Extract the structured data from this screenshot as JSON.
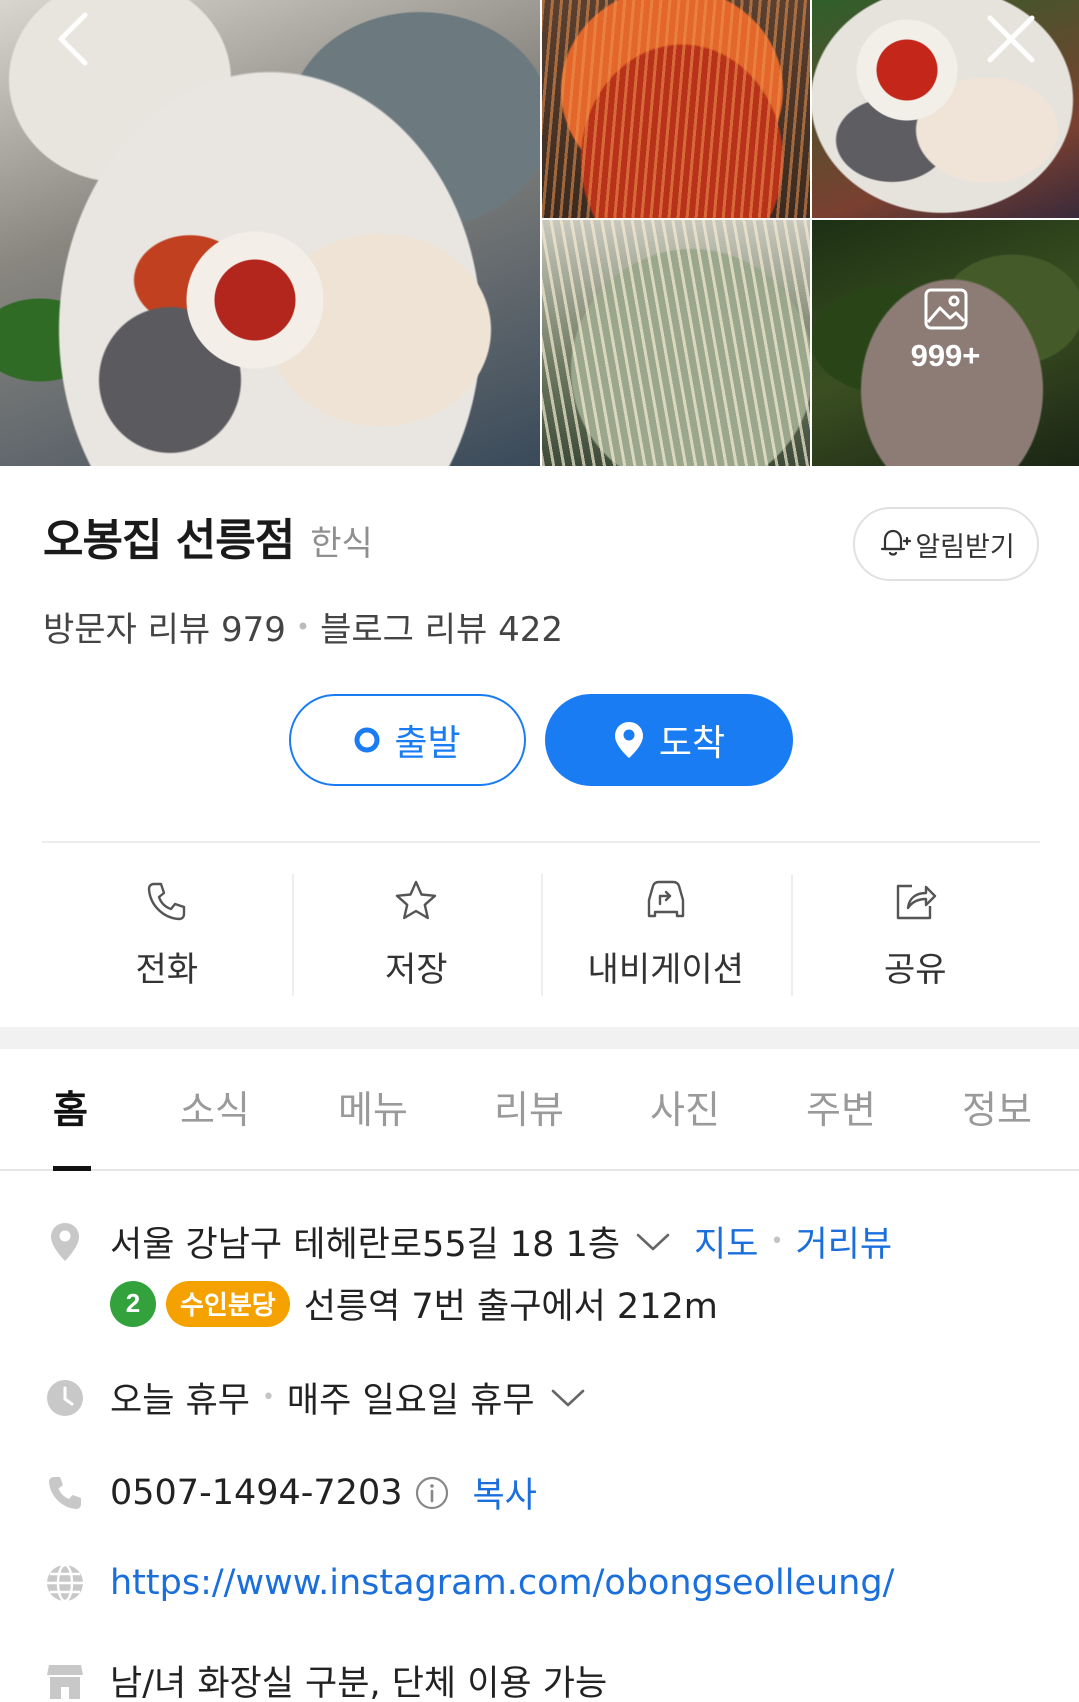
{
  "gallery": {
    "photos": [
      "photo-main",
      "photo-noodles",
      "photo-platter",
      "photo-hotpot",
      "photo-boiled-pork"
    ],
    "more_count": "999+",
    "icons": {
      "back": "chevron-left-icon",
      "close": "close-icon",
      "more": "image-icon"
    }
  },
  "place": {
    "name": "오봉집 선릉점",
    "category": "한식",
    "notify_label": "알림받기",
    "visitor_reviews": "방문자 리뷰 979",
    "blog_reviews": "블로그 리뷰 422",
    "separator": "•"
  },
  "route": {
    "depart_label": "출발",
    "arrive_label": "도착"
  },
  "actions": [
    {
      "label": "전화",
      "icon": "phone-icon"
    },
    {
      "label": "저장",
      "icon": "star-icon"
    },
    {
      "label": "내비게이션",
      "icon": "car-navigation-icon"
    },
    {
      "label": "공유",
      "icon": "share-icon"
    }
  ],
  "tabs": [
    {
      "label": "홈",
      "active": true
    },
    {
      "label": "소식"
    },
    {
      "label": "메뉴"
    },
    {
      "label": "리뷰"
    },
    {
      "label": "사진"
    },
    {
      "label": "주변"
    },
    {
      "label": "정보"
    }
  ],
  "info": {
    "address": "서울 강남구 테헤란로55길 18 1층",
    "map_link": "지도",
    "streetview_link": "거리뷰",
    "subway_line_number": "2",
    "subway_line_name": "수인분당",
    "subway_directions": "선릉역 7번 출구에서 212m",
    "hours_status": "오늘 휴무",
    "hours_detail": "매주 일요일 휴무",
    "phone": "0507-1494-7203",
    "copy_label": "복사",
    "website": "https://www.instagram.com/obongseolleung/",
    "amenities": "남/녀 화장실 구분, 단체 이용 가능"
  },
  "colors": {
    "accent_blue": "#1a7cf3",
    "link_blue": "#1a6fdc",
    "line2_green": "#33a23d",
    "suin_bundang_yellow": "#f5a200"
  }
}
